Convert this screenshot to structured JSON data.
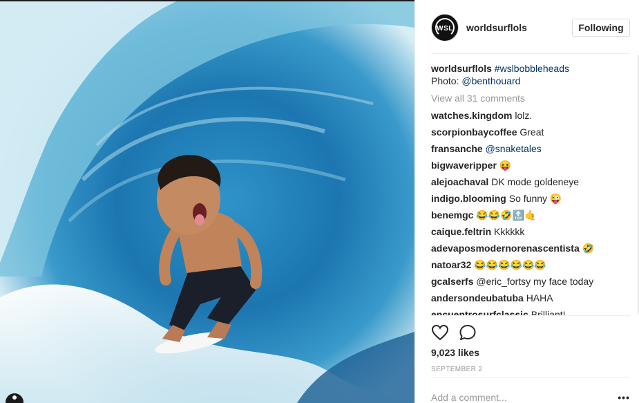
{
  "post": {
    "account": {
      "username": "worldsurflols",
      "avatar_text": "WSL",
      "follow_label": "Following"
    },
    "caption": {
      "username": "worldsurflols",
      "hashtag": "#wslbobbleheads",
      "photo_prefix": "Photo:",
      "photo_credit": "@benthouard"
    },
    "view_all_label": "View all 31 comments",
    "comments": [
      {
        "user": "watches.kingdom",
        "text": "lolz."
      },
      {
        "user": "scorpionbaycoffee",
        "text": "Great"
      },
      {
        "user": "fransanche",
        "text": "@snaketales"
      },
      {
        "user": "bigwaveripper",
        "text": "😝"
      },
      {
        "user": "alejoachaval",
        "text": "DK mode goldeneye"
      },
      {
        "user": "indigo.blooming",
        "text": "So funny 😜"
      },
      {
        "user": "benemgc",
        "text": "😂😂🤣🔝🤙"
      },
      {
        "user": "caique.feltrin",
        "text": "Kkkkkk"
      },
      {
        "user": "adevaposmodernorenascentista",
        "text": "🤣"
      },
      {
        "user": "natoar32",
        "text": "😂😂😂😂😂😂"
      },
      {
        "user": "gcalserfs",
        "text": "@eric_fortsy my face today"
      },
      {
        "user": "andersondeubatuba",
        "text": "HAHA"
      },
      {
        "user": "encuentrosurfclassic",
        "text": "Brilliant!"
      }
    ],
    "likes": "9,023 likes",
    "date": "SEPTEMBER 2",
    "add_comment_placeholder": "Add a comment...",
    "more_label": "•••",
    "icons": {
      "like": "heart-icon",
      "comment": "comment-icon",
      "more": "more-options-icon",
      "user_tag": "user-tag-icon"
    },
    "colors": {
      "link": "#003569",
      "muted": "#999999",
      "text": "#262626",
      "border": "#efefef"
    }
  }
}
